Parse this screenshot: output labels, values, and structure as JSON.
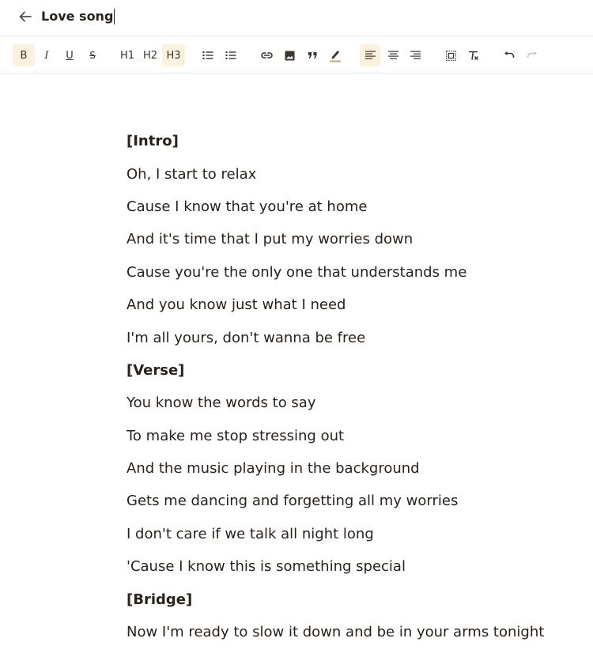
{
  "header": {
    "title": "Love song"
  },
  "toolbar": {
    "bold": "B",
    "italic": "I",
    "underline": "U",
    "strike": "S",
    "h1": "H1",
    "h2": "H2",
    "h3": "H3",
    "active": [
      "bold",
      "h3",
      "align-left"
    ],
    "active_color": "#fbf1dc"
  },
  "lyrics": {
    "lines": [
      {
        "text": "[Intro]",
        "bold": true
      },
      {
        "text": "Oh, I start to relax",
        "bold": false
      },
      {
        "text": "Cause I know that you're at home",
        "bold": false
      },
      {
        "text": "And it's time that I put my worries down",
        "bold": false
      },
      {
        "text": "Cause you're the only one that understands me",
        "bold": false
      },
      {
        "text": "And you know just what I need",
        "bold": false
      },
      {
        "text": "I'm all yours, don't wanna be free",
        "bold": false
      },
      {
        "text": "[Verse]",
        "bold": true
      },
      {
        "text": "You know the words to say",
        "bold": false
      },
      {
        "text": "To make me stop stressing out",
        "bold": false
      },
      {
        "text": "And the music playing in the background",
        "bold": false
      },
      {
        "text": "Gets me dancing and forgetting all my worries",
        "bold": false
      },
      {
        "text": "I don't care if we talk all night long",
        "bold": false
      },
      {
        "text": "'Cause I know this is something special",
        "bold": false
      },
      {
        "text": "[Bridge]",
        "bold": true
      },
      {
        "text": "Now I'm ready to slow it down and be in your arms tonight",
        "bold": false
      }
    ]
  }
}
